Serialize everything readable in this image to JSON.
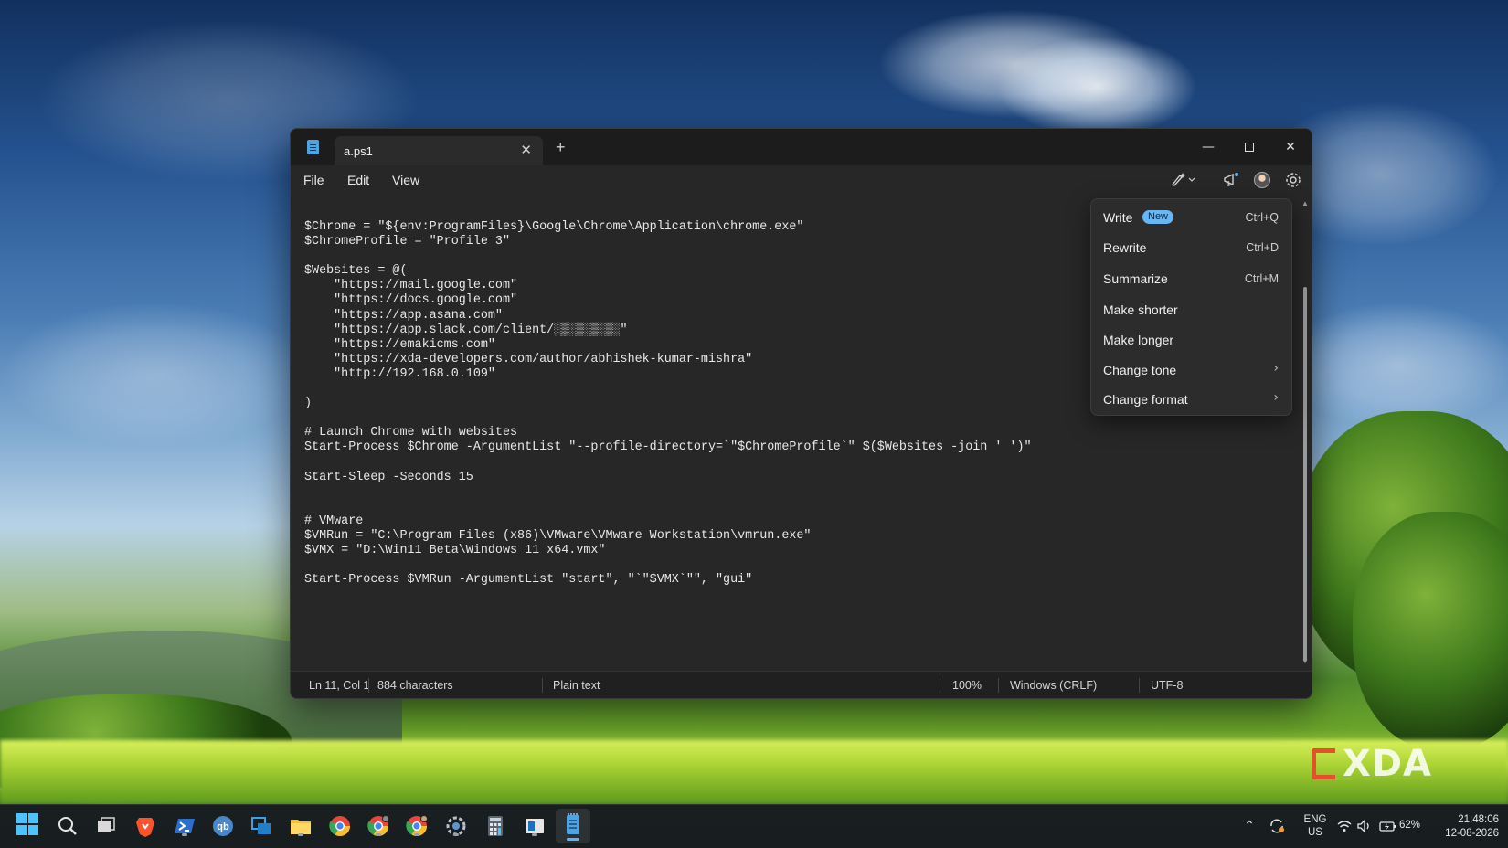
{
  "window": {
    "tab_title": "a.ps1",
    "tab_close": "✕",
    "new_tab": "+",
    "minimize": "—",
    "close": "✕"
  },
  "menu": {
    "file": "File",
    "edit": "Edit",
    "view": "View"
  },
  "editor": {
    "lines": [
      "$Chrome = \"${env:ProgramFiles}\\Google\\Chrome\\Application\\chrome.exe\"",
      "$ChromeProfile = \"Profile 3\"",
      "",
      "$Websites = @(",
      "    \"https://mail.google.com\"",
      "    \"https://docs.google.com\"",
      "    \"https://app.asana.com\"",
      "    \"https://app.slack.com/client/░▒░▒░▒░▒░\"",
      "    \"https://emakicms.com\"",
      "    \"https://xda-developers.com/author/abhishek-kumar-mishra\"",
      "    \"http://192.168.0.109\"",
      "",
      ")",
      "",
      "# Launch Chrome with websites",
      "Start-Process $Chrome -ArgumentList \"--profile-directory=`\"$ChromeProfile`\" $($Websites -join ' ')\"",
      "",
      "Start-Sleep -Seconds 15",
      "",
      "",
      "# VMware",
      "$VMRun = \"C:\\Program Files (x86)\\VMware\\VMware Workstation\\vmrun.exe\"",
      "$VMX = \"D:\\Win11 Beta\\Windows 11 x64.vmx\"",
      "",
      "Start-Process $VMRun -ArgumentList \"start\", \"`\"$VMX`\"\", \"gui\""
    ]
  },
  "ai_menu": {
    "items": [
      {
        "label": "Write",
        "badge": "New",
        "shortcut": "Ctrl+Q"
      },
      {
        "label": "Rewrite",
        "shortcut": "Ctrl+D"
      },
      {
        "label": "Summarize",
        "shortcut": "Ctrl+M"
      },
      {
        "label": "Make shorter"
      },
      {
        "label": "Make longer"
      },
      {
        "label": "Change tone"
      },
      {
        "label": "Change format"
      }
    ]
  },
  "status": {
    "position": "Ln 11, Col 1",
    "characters": "884 characters",
    "format": "Plain text",
    "zoom": "100%",
    "line_ending": "Windows (CRLF)",
    "encoding": "UTF-8"
  },
  "tray": {
    "lang": "ENG",
    "region": "US",
    "battery": "62%",
    "time": "21:48:06",
    "date": "12-08-2026"
  },
  "watermark": "XDA",
  "colors": {
    "accent": "#60b4f5",
    "badge": "#68b6f3",
    "window_bg": "#272727"
  }
}
